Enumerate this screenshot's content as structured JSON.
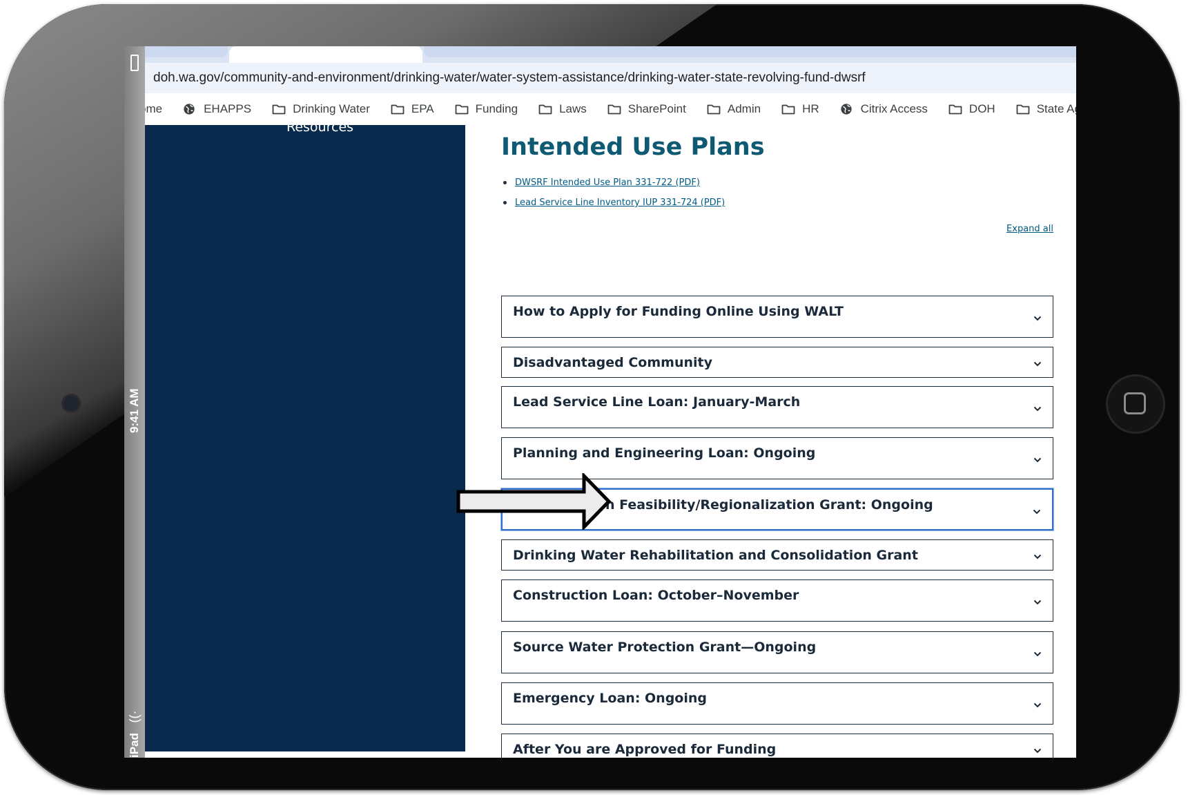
{
  "device": {
    "status_time": "9:41 AM",
    "device_name": "iPad"
  },
  "browser": {
    "url": "doh.wa.gov/community-and-environment/drinking-water/water-system-assistance/drinking-water-state-revolving-fund-dwsrf",
    "bookmarks": [
      {
        "label": "ome",
        "icon": "folder-icon"
      },
      {
        "label": "EHAPPS",
        "icon": "globe-icon"
      },
      {
        "label": "Drinking Water",
        "icon": "folder-icon"
      },
      {
        "label": "EPA",
        "icon": "folder-icon"
      },
      {
        "label": "Funding",
        "icon": "folder-icon"
      },
      {
        "label": "Laws",
        "icon": "folder-icon"
      },
      {
        "label": "SharePoint",
        "icon": "folder-icon"
      },
      {
        "label": "Admin",
        "icon": "folder-icon"
      },
      {
        "label": "HR",
        "icon": "folder-icon"
      },
      {
        "label": "Citrix Access",
        "icon": "globe-icon"
      },
      {
        "label": "DOH",
        "icon": "folder-icon"
      },
      {
        "label": "State Agencies",
        "icon": "folder-icon"
      }
    ]
  },
  "sidebar": {
    "label": "Resources"
  },
  "main": {
    "title": "Intended Use Plans",
    "documents": [
      "DWSRF Intended Use Plan 331-722 (PDF)",
      "Lead Service Line Inventory IUP 331-724 (PDF)"
    ],
    "expand_all": "Expand all",
    "accordions": [
      "How to Apply for Funding Online Using WALT",
      "Disadvantaged Community",
      "Lead Service Line Loan: January-March",
      "Planning and Engineering Loan: Ongoing",
      "Consolidation Feasibility/Regionalization Grant: Ongoing",
      "Drinking Water Rehabilitation and Consolidation Grant",
      "Construction Loan: October–November",
      "Source Water Protection Grant—Ongoing",
      "Emergency Loan: Ongoing",
      "After You are Approved for Funding"
    ],
    "focused_accordion": "Consolidation Feasibility/Regionalization Grant: Ongoing"
  },
  "colors": {
    "title": "#0f5a73",
    "sidebar_bg": "#0a2a4d",
    "link": "#005b85",
    "focus": "#2f6fcf"
  }
}
